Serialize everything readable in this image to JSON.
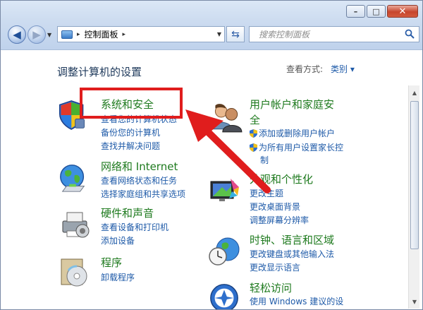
{
  "window": {
    "caption": {
      "minimize": "–",
      "maximize": "□",
      "close": "✕"
    }
  },
  "toolbar": {
    "back_icon": "arrow-left",
    "forward_icon": "arrow-right",
    "address": {
      "separator": "▸",
      "path": "控制面板",
      "trailing_separator": "▸"
    },
    "refresh_icon": "refresh-arrows",
    "search": {
      "placeholder": "搜索控制面板"
    }
  },
  "main": {
    "heading": "调整计算机的设置",
    "view_by_label": "查看方式:",
    "view_by_value": "类别 ▾",
    "categories_left": [
      {
        "title": "系统和安全",
        "links": [
          "查看您的计算机状态",
          "备份您的计算机",
          "查找并解决问题"
        ],
        "icon": "shield-icon"
      },
      {
        "title": "网络和 Internet",
        "links": [
          "查看网络状态和任务",
          "选择家庭组和共享选项"
        ],
        "icon": "globe-network-icon"
      },
      {
        "title": "硬件和声音",
        "links": [
          "查看设备和打印机",
          "添加设备"
        ],
        "icon": "printer-icon"
      },
      {
        "title": "程序",
        "links": [
          "卸载程序"
        ],
        "icon": "programs-icon"
      }
    ],
    "categories_right": [
      {
        "title_line1": "用户帐户和家庭安",
        "title_line2": "全",
        "links": [
          "添加或删除用户帐户",
          "为所有用户设置家长控",
          "制"
        ],
        "icon": "users-icon"
      },
      {
        "title": "外观和个性化",
        "links": [
          "更改主题",
          "更改桌面背景",
          "调整屏幕分辨率"
        ],
        "icon": "monitor-icon"
      },
      {
        "title": "时钟、语言和区域",
        "links": [
          "更改键盘或其他输入法",
          "更改显示语言"
        ],
        "icon": "clock-globe-icon"
      },
      {
        "title": "轻松访问",
        "links": [
          "使用 Windows 建议的设"
        ],
        "icon": "ease-of-access-icon"
      }
    ]
  },
  "annotation": {
    "color": "#e01d1d"
  }
}
